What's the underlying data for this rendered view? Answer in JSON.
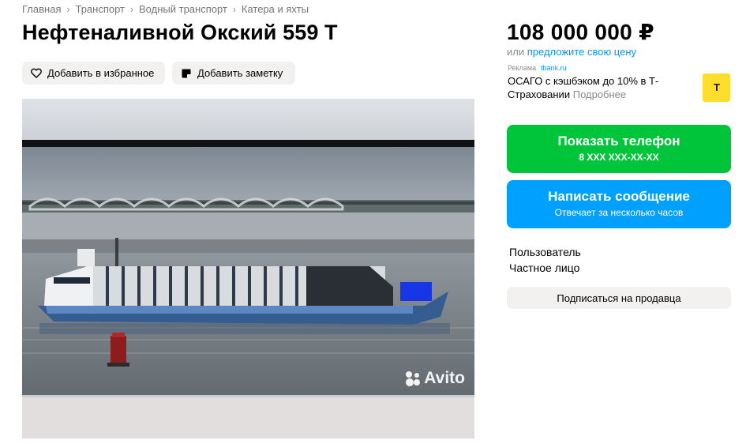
{
  "breadcrumb": [
    "Главная",
    "Транспорт",
    "Водный транспорт",
    "Катера и яхты"
  ],
  "title": "Нефтеналивной Окский 559 Т",
  "actions": {
    "favorite_label": "Добавить в избранное",
    "note_label": "Добавить заметку"
  },
  "gallery": {
    "watermark": "Avito"
  },
  "price": {
    "value": "108 000 000 ₽",
    "offer_prefix": "или",
    "offer_link": "предложите свою цену"
  },
  "ad": {
    "label": "Реклама",
    "domain": "tbank.ru",
    "text": "ОСАГО с кэшбэком до 10% в Т-Страховании",
    "more": "Подробнее",
    "logo_letter": "Т",
    "logo_color": "#ffdd2d"
  },
  "contact": {
    "phone_label": "Показать телефон",
    "phone_masked": "8 XXX XXX-XX-XX",
    "message_label": "Написать сообщение",
    "message_sub": "Отвечает за несколько часов",
    "phone_color": "#00c53a",
    "message_color": "#00a0ff"
  },
  "seller": {
    "name": "Пользователь",
    "type": "Частное лицо",
    "subscribe_label": "Подписаться на продавца"
  }
}
